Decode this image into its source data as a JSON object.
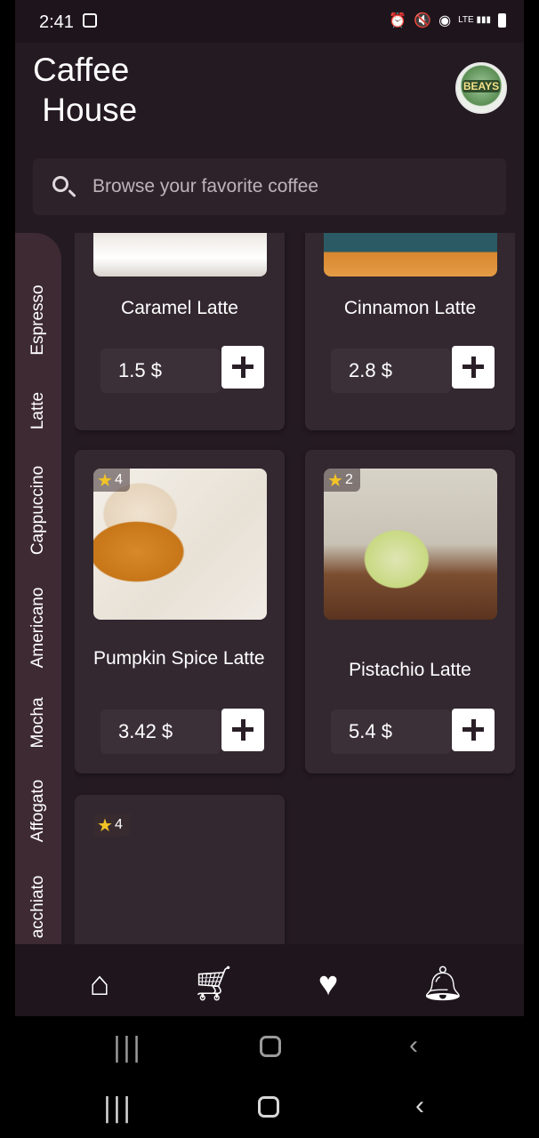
{
  "status_bar": {
    "time": "2:41",
    "icons": [
      "alarm-icon",
      "mute-icon",
      "hotspot-icon",
      "lte-signal-icon",
      "battery-icon"
    ],
    "lte_label": "LTE"
  },
  "header": {
    "title": "Caffee\n House",
    "avatar_text": "BEAYS"
  },
  "search": {
    "placeholder": "Browse your favorite coffee"
  },
  "categories": [
    "Espresso",
    "Latte",
    "Cappuccino",
    "Americano",
    "Mocha",
    "Affogato",
    "acchiato"
  ],
  "products": [
    {
      "name": "Caramel Latte",
      "price": "1.5 $",
      "rating": null
    },
    {
      "name": "Cinnamon Latte",
      "price": "2.8 $",
      "rating": null
    },
    {
      "name": "Pumpkin Spice Latte",
      "price": "3.42 $",
      "rating": "4"
    },
    {
      "name": "Pistachio Latte",
      "price": "5.4 $",
      "rating": "2"
    },
    {
      "name": "",
      "price": "",
      "rating": "4"
    }
  ],
  "bottom_nav": [
    "home-icon",
    "cart-icon",
    "favorite-icon",
    "notification-icon"
  ],
  "colors": {
    "background": "#241a21",
    "card": "#332830",
    "category_bar": "#3e2a33",
    "star": "#f2c326"
  }
}
